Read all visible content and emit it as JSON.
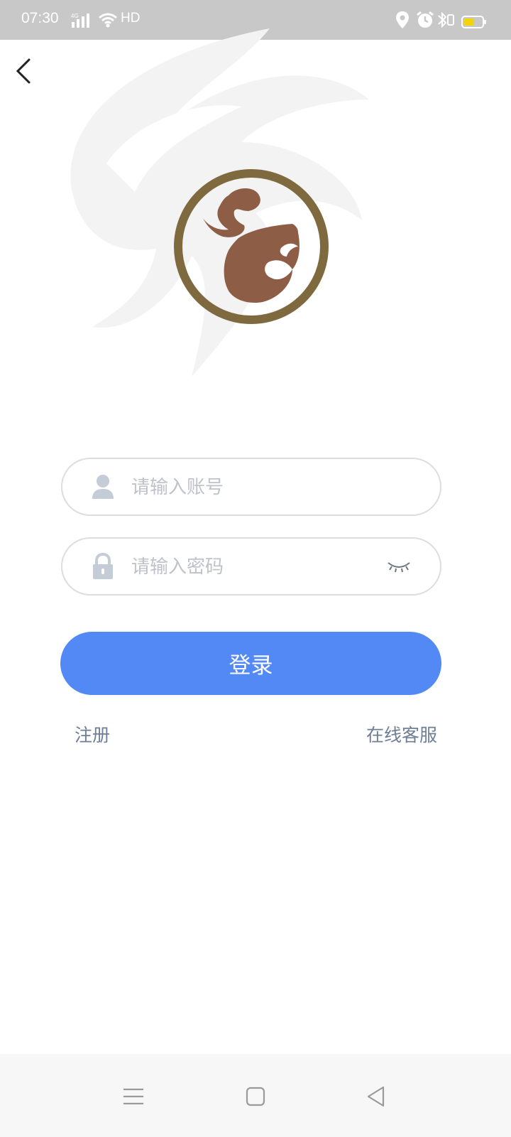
{
  "status_bar": {
    "time": "07:30",
    "network_badge": "4G",
    "hd_label": "HD",
    "icons": [
      "signal-icon",
      "wifi-icon",
      "location-icon",
      "alarm-icon",
      "bluetooth-icon",
      "battery-icon"
    ],
    "battery_color": "#f2d40a"
  },
  "header": {
    "back_icon": "chevron-left-icon"
  },
  "logo": {
    "ring_color": "#7f6a3f",
    "mark_color": "#8e5d45"
  },
  "form": {
    "account_placeholder": "请输入账号",
    "password_placeholder": "请输入密码",
    "account_icon": "user-icon",
    "password_icon": "lock-icon",
    "visibility_icon": "eye-closed-icon",
    "login_label": "登录",
    "login_color": "#5289f5"
  },
  "links": {
    "register": "注册",
    "support": "在线客服"
  },
  "nav_bar": {
    "icons": [
      "menu-icon",
      "home-icon",
      "back-icon"
    ]
  }
}
